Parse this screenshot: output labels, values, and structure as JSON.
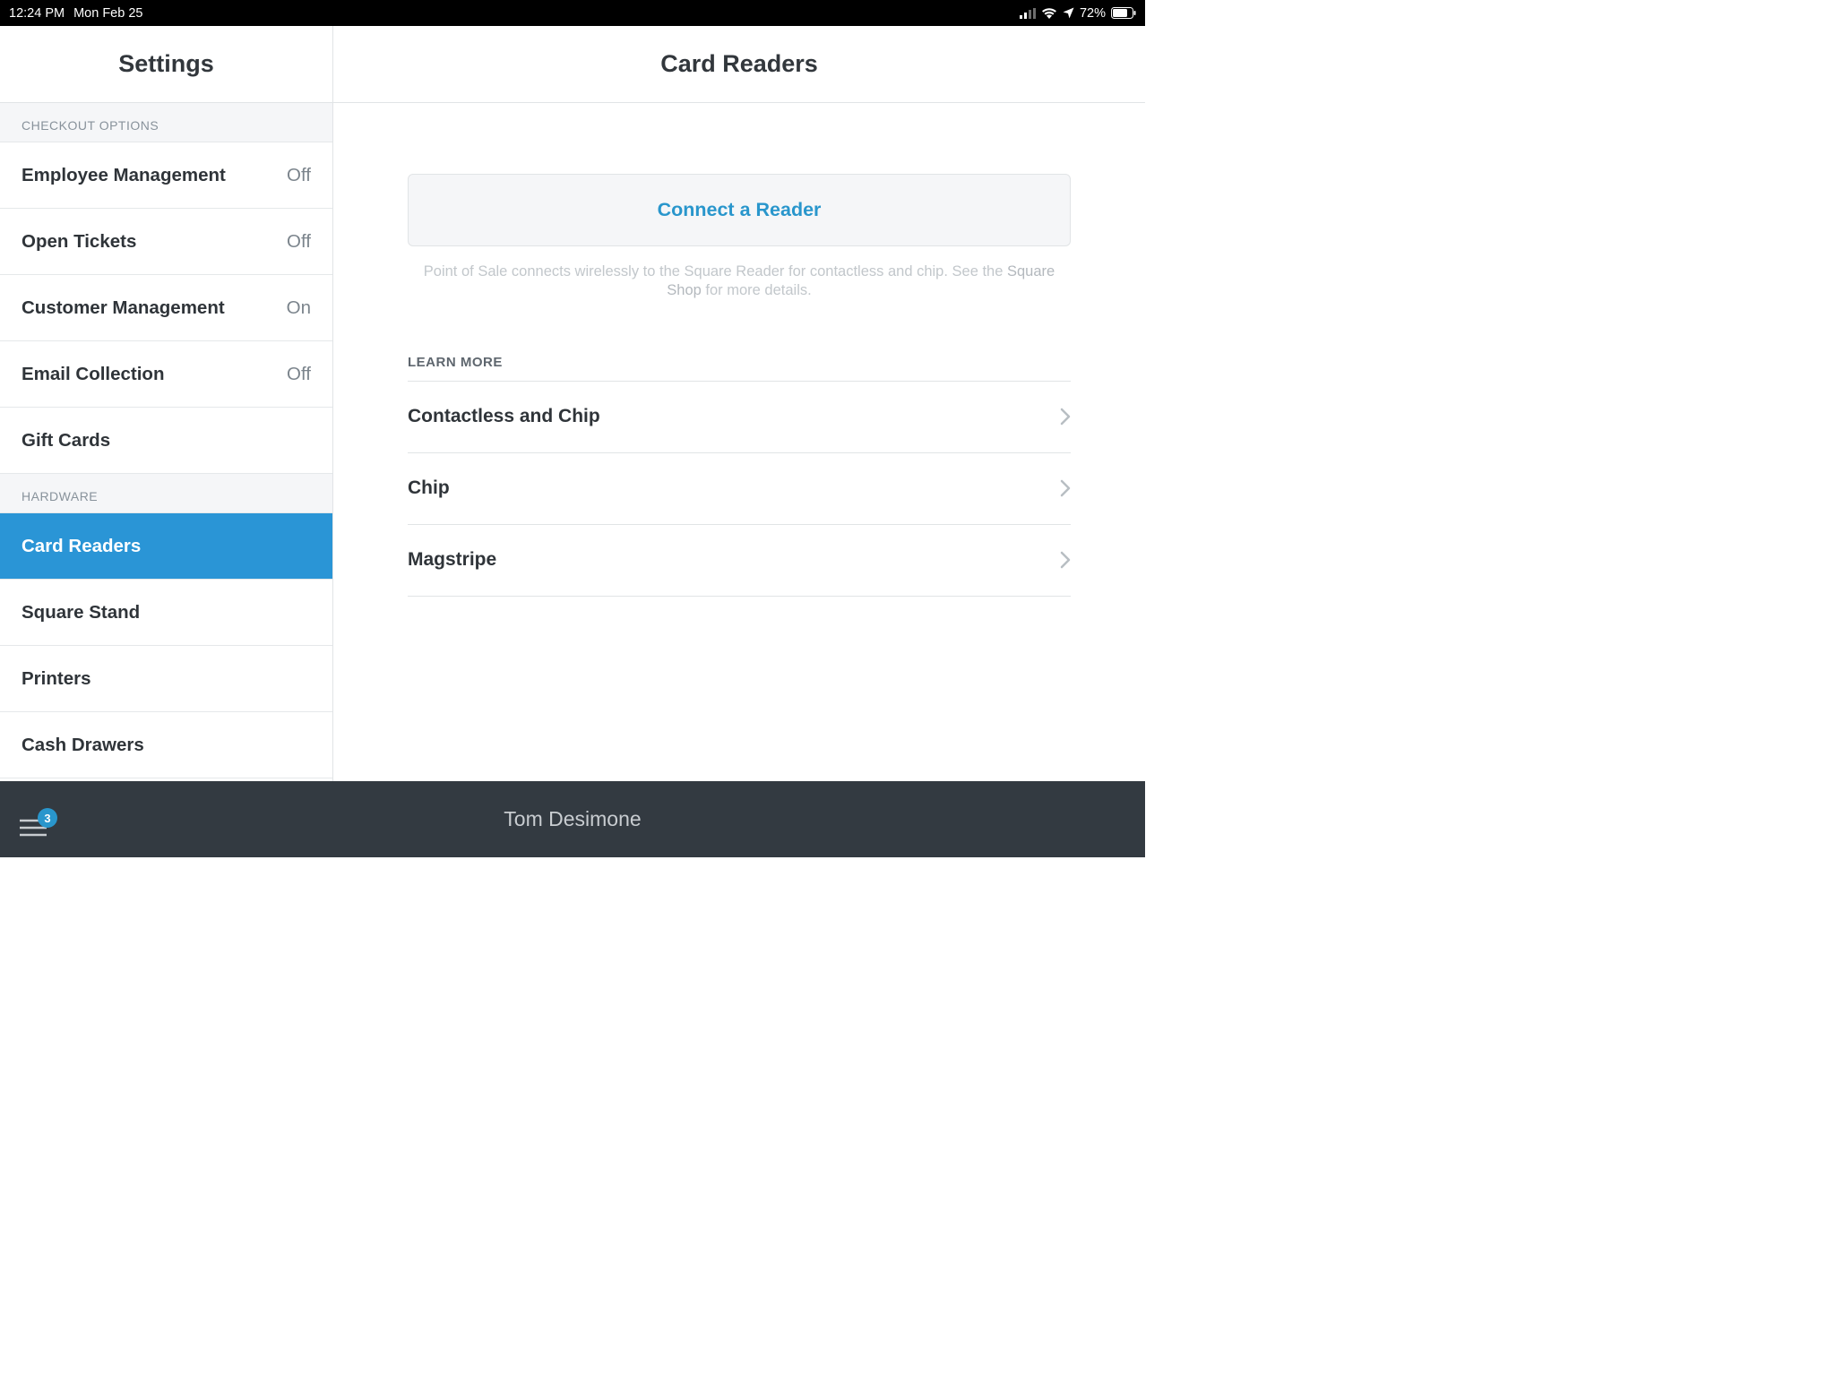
{
  "statusbar": {
    "time": "12:24 PM",
    "date": "Mon Feb 25",
    "battery_pct": "72%"
  },
  "sidebar": {
    "title": "Settings",
    "sections": [
      {
        "header": "CHECKOUT OPTIONS",
        "items": [
          {
            "label": "Employee Management",
            "value": "Off",
            "selected": false
          },
          {
            "label": "Open Tickets",
            "value": "Off",
            "selected": false
          },
          {
            "label": "Customer Management",
            "value": "On",
            "selected": false
          },
          {
            "label": "Email Collection",
            "value": "Off",
            "selected": false
          },
          {
            "label": "Gift Cards",
            "value": "",
            "selected": false
          }
        ]
      },
      {
        "header": "HARDWARE",
        "items": [
          {
            "label": "Card Readers",
            "value": "",
            "selected": true
          },
          {
            "label": "Square Stand",
            "value": "",
            "selected": false
          },
          {
            "label": "Printers",
            "value": "",
            "selected": false
          },
          {
            "label": "Cash Drawers",
            "value": "",
            "selected": false
          }
        ]
      }
    ]
  },
  "detail": {
    "title": "Card Readers",
    "connect_button": "Connect a Reader",
    "help_prefix": "Point of Sale connects wirelessly to the Square Reader for contactless and chip. See the ",
    "help_link": "Square Shop",
    "help_suffix": " for more details.",
    "learn_more_header": "LEARN MORE",
    "learn_more_items": [
      {
        "label": "Contactless and Chip"
      },
      {
        "label": "Chip"
      },
      {
        "label": "Magstripe"
      }
    ]
  },
  "bottombar": {
    "badge": "3",
    "account": "Tom Desimone"
  }
}
